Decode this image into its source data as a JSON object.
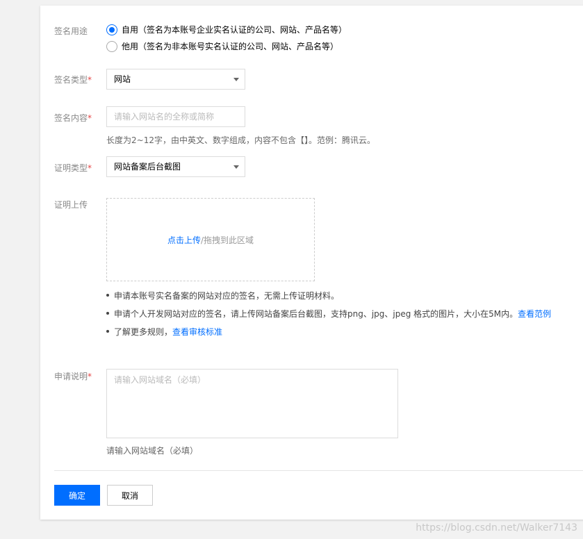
{
  "form": {
    "usage": {
      "label": "签名用途",
      "options": [
        {
          "text": "自用（签名为本账号企业实名认证的公司、网站、产品名等）",
          "selected": true
        },
        {
          "text": "他用（签名为非本账号实名认证的公司、网站、产品名等）",
          "selected": false
        }
      ]
    },
    "sign_type": {
      "label": "签名类型",
      "value": "网站"
    },
    "sign_content": {
      "label": "签名内容",
      "placeholder": "请输入网站名的全称或简称",
      "hint": "长度为2~12字，由中英文、数字组成，内容不包含【】。范例：腾讯云。"
    },
    "proof_type": {
      "label": "证明类型",
      "value": "网站备案后台截图"
    },
    "proof_upload": {
      "label": "证明上传",
      "click_text": "点击上传",
      "drag_text": "/拖拽到此区域",
      "notes": [
        {
          "text": "申请本账号实名备案的网站对应的签名，无需上传证明材料。",
          "link": ""
        },
        {
          "text": "申请个人开发网站对应的签名，请上传网站备案后台截图，支持png、jpg、jpeg 格式的图片，大小在5M内。",
          "link": "查看范例"
        },
        {
          "text": "了解更多规则，",
          "link": "查看审核标准"
        }
      ]
    },
    "apply_desc": {
      "label": "申请说明",
      "placeholder": "请输入网站域名（必填）",
      "hint": "请输入网站域名（必填）"
    },
    "required_mark": "*"
  },
  "actions": {
    "confirm": "确定",
    "cancel": "取消"
  },
  "watermark": "https://blog.csdn.net/Walker7143",
  "colors": {
    "accent": "#006eff",
    "required": "#e54545"
  }
}
